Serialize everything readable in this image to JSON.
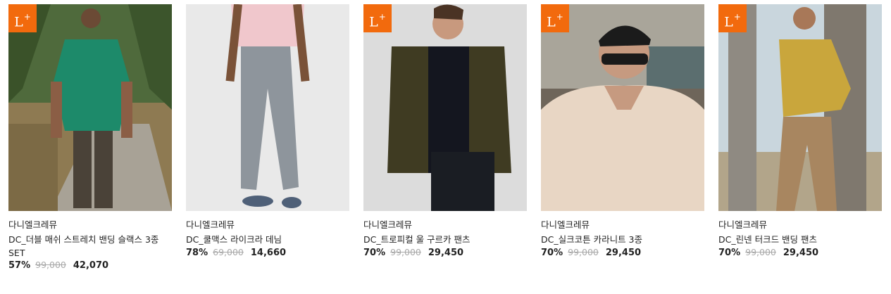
{
  "products": [
    {
      "badge": "L",
      "badge_sup": "+",
      "brand": "다니엘크레뮤",
      "name": "DC_더블 매쉬 스트레치 밴딩 슬랙스 3종 SET",
      "discount": "57%",
      "original_price": "99,000",
      "sale_price": "42,070"
    },
    {
      "badge": "",
      "badge_sup": "",
      "brand": "다니엘크레뮤",
      "name": "DC_쿨맥스 라이크라 데님",
      "discount": "78%",
      "original_price": "69,000",
      "sale_price": "14,660"
    },
    {
      "badge": "L",
      "badge_sup": "+",
      "brand": "다니엘크레뮤",
      "name": "DC_트로피컬 울 구르카 팬츠",
      "discount": "70%",
      "original_price": "99,000",
      "sale_price": "29,450"
    },
    {
      "badge": "L",
      "badge_sup": "+",
      "brand": "다니엘크레뮤",
      "name": "DC_실크코튼 카라니트 3종",
      "discount": "70%",
      "original_price": "99,000",
      "sale_price": "29,450"
    },
    {
      "badge": "L",
      "badge_sup": "+",
      "brand": "다니엘크레뮤",
      "name": "DC_린넨 터크드 밴딩 팬츠",
      "discount": "70%",
      "original_price": "99,000",
      "sale_price": "29,450"
    }
  ],
  "colors": {
    "badge": "#f26a0d",
    "strike": "#a8a8a8"
  }
}
